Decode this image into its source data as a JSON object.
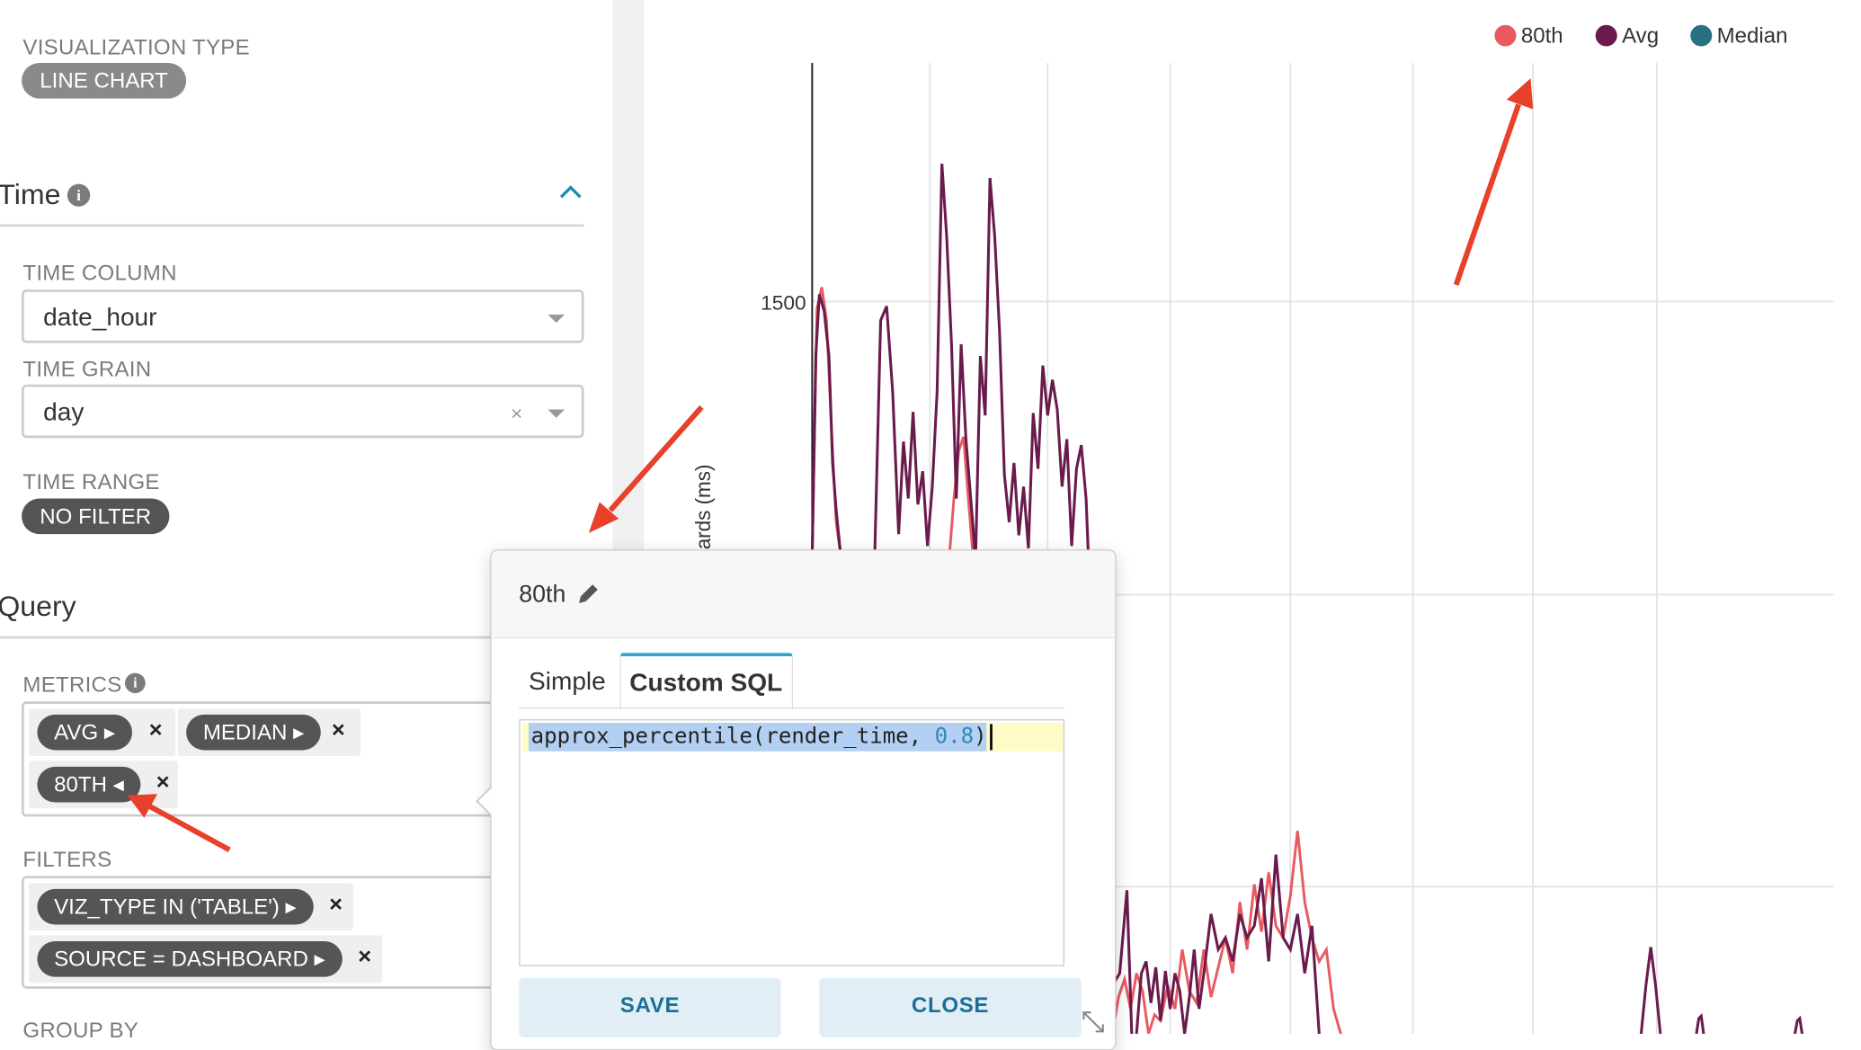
{
  "visualization": {
    "label": "VISUALIZATION TYPE",
    "value": "LINE CHART"
  },
  "time_section": {
    "title": "Time",
    "time_column": {
      "label": "TIME COLUMN",
      "value": "date_hour"
    },
    "time_grain": {
      "label": "TIME GRAIN",
      "value": "day",
      "clear": "×"
    },
    "time_range": {
      "label": "TIME RANGE",
      "value": "NO FILTER"
    }
  },
  "query_section": {
    "title": "Query",
    "metrics": {
      "label": "METRICS",
      "items": [
        {
          "label": "AVG ▸",
          "remove": "×"
        },
        {
          "label": "MEDIAN ▸",
          "remove": "×"
        },
        {
          "label": "80TH ◂",
          "remove": "×"
        }
      ]
    },
    "filters": {
      "label": "FILTERS",
      "items": [
        {
          "label": "VIZ_TYPE IN ('TABLE') ▸",
          "remove": "×"
        },
        {
          "label": "SOURCE = DASHBOARD ▸",
          "remove": "×"
        }
      ]
    },
    "group_by": {
      "label": "GROUP BY"
    }
  },
  "popover": {
    "title": "80th",
    "tabs": [
      "Simple",
      "Custom SQL"
    ],
    "active_tab": "Custom SQL",
    "sql": {
      "fn": "approx_percentile",
      "open": "(",
      "arg": "render_time, ",
      "num": "0.8",
      "close": ")"
    },
    "save_label": "SAVE",
    "close_label": "CLOSE"
  },
  "chart_data": {
    "type": "line",
    "series": [
      {
        "name": "80th",
        "color": "#e85a5f"
      },
      {
        "name": "Avg",
        "color": "#6a1b4d"
      },
      {
        "name": "Median",
        "color": "#2b6f82"
      }
    ],
    "ylabel_visible": "ards (ms)",
    "y_tick": "1500",
    "legend_position": "top-right",
    "grid": true
  },
  "colors": {
    "avg": "#6a1b4d",
    "p80": "#e85a5f",
    "median": "#2b6f82",
    "annotation": "#e8402a",
    "button_text": "#1c6e96"
  }
}
